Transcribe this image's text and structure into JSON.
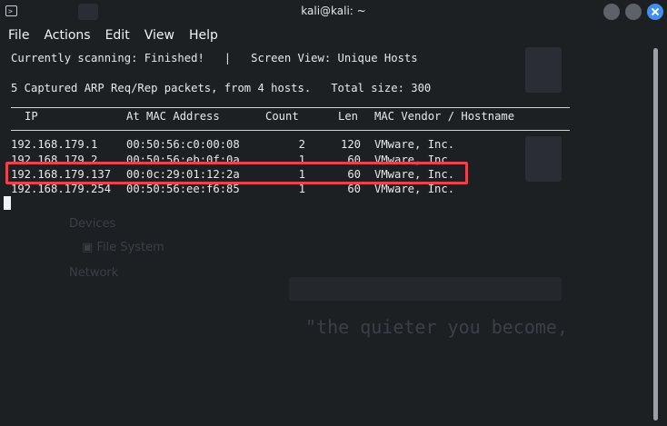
{
  "window": {
    "title": "kali@kali: ~"
  },
  "menu": [
    "File",
    "Actions",
    "Edit",
    "View",
    "Help"
  ],
  "terminal": {
    "status_line": "Currently scanning: Finished!   |   Screen View: Unique Hosts",
    "summary_line": "5 Captured ARP Req/Rep packets, from 4 hosts.   Total size: 300",
    "headers": {
      "ip": "IP",
      "mac": "At MAC Address",
      "count": "Count",
      "len": "Len",
      "vendor": "MAC Vendor / Hostname"
    },
    "rows": [
      {
        "ip": "192.168.179.1",
        "mac": "00:50:56:c0:00:08",
        "count": "2",
        "len": "120",
        "vendor": "VMware, Inc."
      },
      {
        "ip": "192.168.179.2",
        "mac": "00:50:56:eb:0f:0a",
        "count": "1",
        "len": "60",
        "vendor": "VMware, Inc."
      },
      {
        "ip": "192.168.179.137",
        "mac": "00:0c:29:01:12:2a",
        "count": "1",
        "len": "60",
        "vendor": "VMware, Inc."
      },
      {
        "ip": "192.168.179.254",
        "mac": "00:50:56:ee:f6:85",
        "count": "1",
        "len": "60",
        "vendor": "VMware, Inc."
      }
    ],
    "highlighted_row": 2
  },
  "colors": {
    "background": "#1d2023",
    "text": "#e8e9eb",
    "highlight_border": "#e8434f",
    "close_button": "#3f8ff0"
  },
  "icons": [
    "terminal-icon",
    "minimize-icon",
    "maximize-icon",
    "close-icon"
  ]
}
